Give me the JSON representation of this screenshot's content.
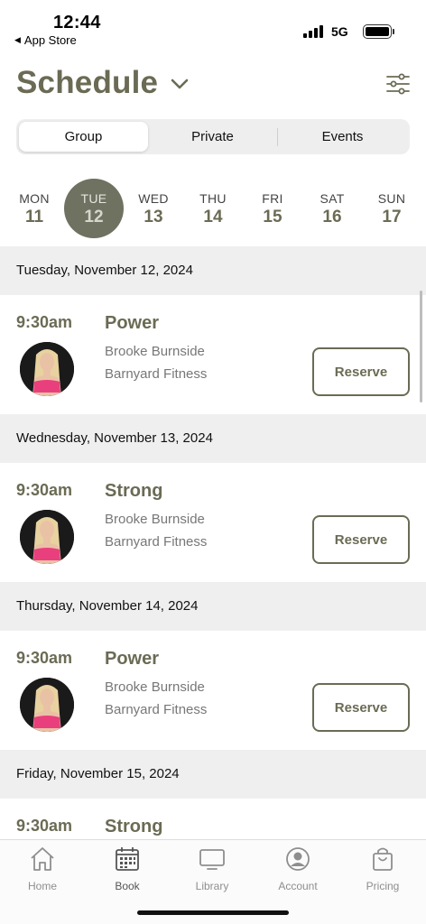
{
  "status": {
    "time": "12:44",
    "back_app": "App Store",
    "network": "5G"
  },
  "header": {
    "title": "Schedule"
  },
  "segments": [
    {
      "label": "Group",
      "active": true
    },
    {
      "label": "Private",
      "active": false
    },
    {
      "label": "Events",
      "active": false
    }
  ],
  "week": [
    {
      "dow": "MON",
      "num": "11",
      "selected": false
    },
    {
      "dow": "TUE",
      "num": "12",
      "selected": true
    },
    {
      "dow": "WED",
      "num": "13",
      "selected": false
    },
    {
      "dow": "THU",
      "num": "14",
      "selected": false
    },
    {
      "dow": "FRI",
      "num": "15",
      "selected": false
    },
    {
      "dow": "SAT",
      "num": "16",
      "selected": false
    },
    {
      "dow": "SUN",
      "num": "17",
      "selected": false
    }
  ],
  "schedule": [
    {
      "date": "Tuesday, November 12, 2024",
      "time": "9:30am",
      "class_name": "Power",
      "instructor": "Brooke Burnside",
      "studio": "Barnyard Fitness",
      "action": "Reserve"
    },
    {
      "date": "Wednesday, November 13, 2024",
      "time": "9:30am",
      "class_name": "Strong",
      "instructor": "Brooke Burnside",
      "studio": "Barnyard Fitness",
      "action": "Reserve"
    },
    {
      "date": "Thursday, November 14, 2024",
      "time": "9:30am",
      "class_name": "Power",
      "instructor": "Brooke Burnside",
      "studio": "Barnyard Fitness",
      "action": "Reserve"
    },
    {
      "date": "Friday, November 15, 2024",
      "time": "9:30am",
      "class_name": "Strong"
    }
  ],
  "tabs": [
    {
      "label": "Home",
      "icon": "home-icon",
      "active": false
    },
    {
      "label": "Book",
      "icon": "calendar-icon",
      "active": true
    },
    {
      "label": "Library",
      "icon": "monitor-icon",
      "active": false
    },
    {
      "label": "Account",
      "icon": "account-icon",
      "active": false
    },
    {
      "label": "Pricing",
      "icon": "shopping-bag-icon",
      "active": false
    }
  ],
  "colors": {
    "accent": "#6b6b55",
    "selected_day": "#6f7161",
    "date_header_bg": "#efefef",
    "instructor_avatar_top": "#e9407d"
  }
}
